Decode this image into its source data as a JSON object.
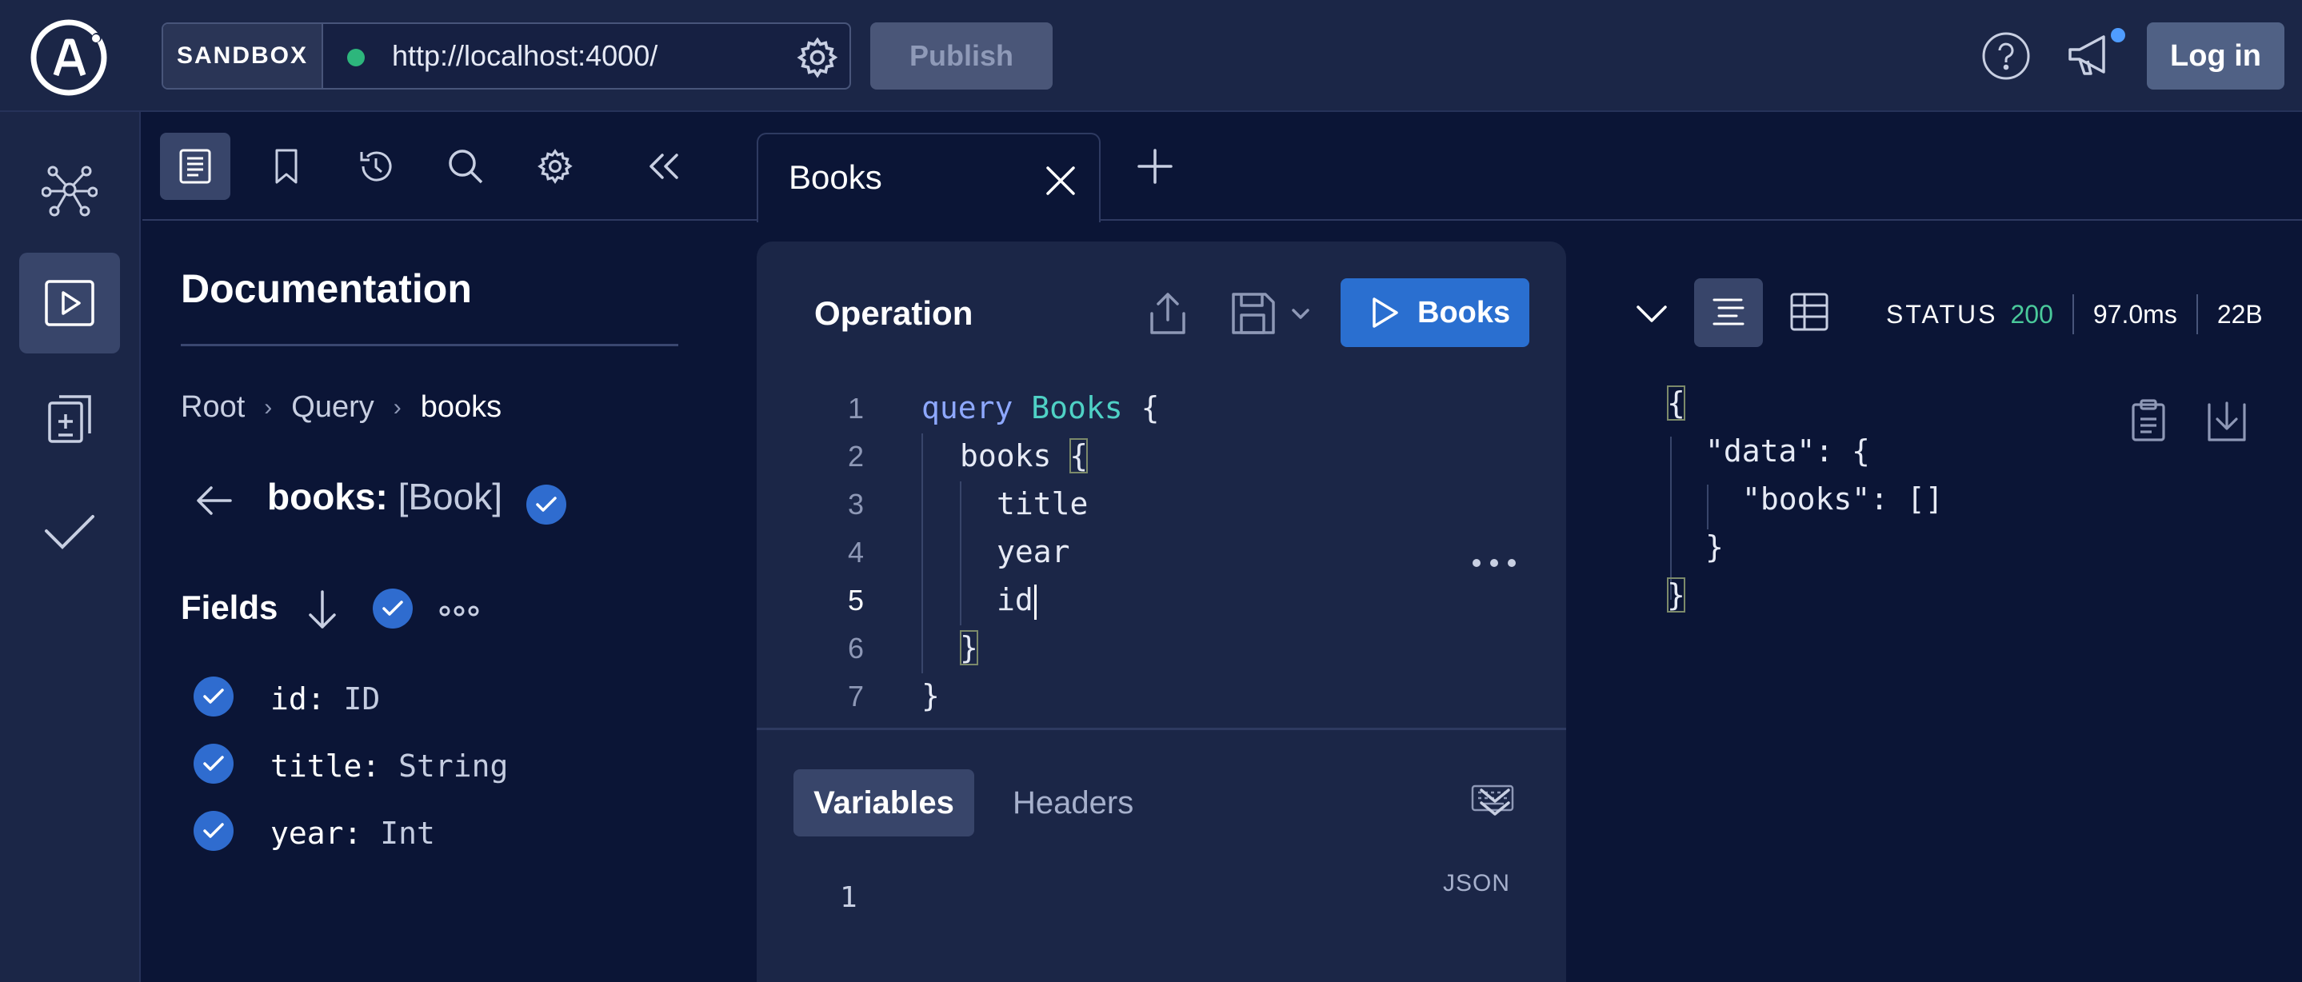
{
  "header": {
    "sandbox_label": "SANDBOX",
    "url": "http://localhost:4000/",
    "publish_label": "Publish",
    "login_label": "Log in",
    "status_color": "#2db67c",
    "icons": [
      "apollo-logo-icon",
      "gear-icon",
      "help-icon",
      "megaphone-icon"
    ]
  },
  "left_rail": {
    "items": [
      {
        "name": "schema",
        "icon": "graph-icon"
      },
      {
        "name": "explorer",
        "icon": "play-icon",
        "active": true
      },
      {
        "name": "operations",
        "icon": "clipboard-icon"
      },
      {
        "name": "checks",
        "icon": "checkmark-icon"
      }
    ]
  },
  "docs_toolbar": {
    "items": [
      "documentation-icon",
      "bookmark-icon",
      "history-icon",
      "search-icon",
      "settings-icon",
      "collapse-icon"
    ]
  },
  "tabs": [
    {
      "label": "Books",
      "active": true
    }
  ],
  "documentation": {
    "title": "Documentation",
    "breadcrumb": [
      "Root",
      "Query",
      "books"
    ],
    "field_name": "books:",
    "field_type": "[Book]",
    "fields_label": "Fields",
    "fields": [
      {
        "name": "id:",
        "type": "ID"
      },
      {
        "name": "title:",
        "type": "String"
      },
      {
        "name": "year:",
        "type": "Int"
      }
    ]
  },
  "operation": {
    "title": "Operation",
    "run_label": "Books",
    "line_numbers": [
      "1",
      "2",
      "3",
      "4",
      "5",
      "6",
      "7"
    ],
    "code": {
      "keyword": "query",
      "op_name": "Books",
      "open": "{",
      "field_root": "books",
      "inner_open": "{",
      "f1": "title",
      "f2": "year",
      "f3": "id",
      "inner_close": "}",
      "close": "}"
    },
    "vars_tab": "Variables",
    "headers_tab": "Headers",
    "var_line": "1",
    "json_label": "JSON"
  },
  "response": {
    "status_label": "STATUS",
    "status_code": "200",
    "time": "97.0ms",
    "size": "22B",
    "lines": [
      "{",
      "\"data\": {",
      "\"books\": []",
      "}",
      "}"
    ]
  },
  "colors": {
    "background": "#0b1536",
    "panel": "#1b2647",
    "accent": "#2a6fd0",
    "keyword": "#8ea8ff",
    "operation_name": "#4fd1c5",
    "status_ok": "#4ac99b"
  }
}
